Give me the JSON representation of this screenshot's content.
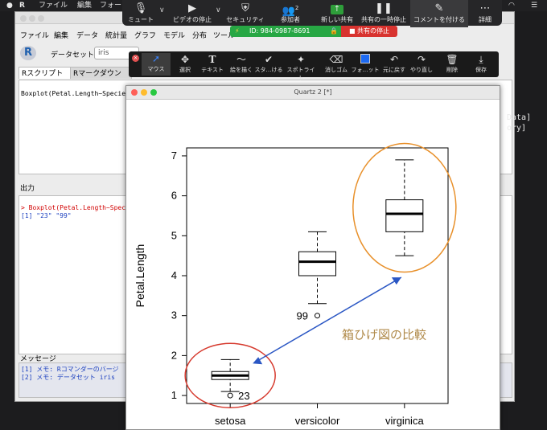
{
  "menubar": {
    "apple": "",
    "app": "R",
    "file": "ファイル",
    "edit": "編集",
    "format": "フォー"
  },
  "rcmdr": {
    "menu": [
      "ファイル",
      "編集",
      "データ",
      "統計量",
      "グラフ",
      "モデル",
      "分布",
      "ツール"
    ],
    "dataset_label": "データセット：",
    "dataset_value": "iris",
    "tabs": {
      "script": "Rスクリプト",
      "markdown": "Rマークダウン"
    },
    "script_text": "Boxplot(Petal.Length~Specie",
    "output_label": "出力",
    "output_lines": [
      "> Boxplot(Petal.Length~Spec",
      "[1] \"23\" \"99\""
    ],
    "messages_label": "メッセージ",
    "messages": [
      "[1] メモ: Rコマンダーのバージ",
      "[2] メモ: データセット iris"
    ],
    "right_text": [
      "Data]",
      "ory]"
    ]
  },
  "zoom": {
    "mute": "ミュート",
    "video": "ビデオの停止",
    "security": "セキュリティ",
    "participants": "参加者",
    "participants_count": "2",
    "share": "新しい共有",
    "pause": "共有の一時停止",
    "annotate": "コメントを付ける",
    "more": "詳細",
    "meeting_id": "ID: 984-0987-8691",
    "stop_share": "共有の停止"
  },
  "annotate_tools": {
    "mouse": "マウス",
    "select": "選択",
    "text": "テキスト",
    "draw": "絵を描く",
    "stamp": "スタ…ける",
    "spotlight": "スポトライト",
    "eraser": "消しゴム",
    "format": "フォ…ット",
    "undo": "元に戻す",
    "redo": "やり直し",
    "delete": "削除",
    "save": "保存"
  },
  "quartz": {
    "title": "Quartz 2 [*]"
  },
  "chart_data": {
    "type": "boxplot",
    "title": "",
    "xlabel": "",
    "ylabel": "Petal.Length",
    "ylim": [
      0.8,
      7.2
    ],
    "yticks": [
      1,
      2,
      3,
      4,
      5,
      6,
      7
    ],
    "categories": [
      "setosa",
      "versicolor",
      "virginica"
    ],
    "boxes": [
      {
        "whisker_low": 1.1,
        "q1": 1.4,
        "median": 1.5,
        "q3": 1.6,
        "whisker_high": 1.9,
        "outliers": [
          {
            "value": 1.0,
            "label": "23"
          }
        ]
      },
      {
        "whisker_low": 3.3,
        "q1": 4.0,
        "median": 4.35,
        "q3": 4.6,
        "whisker_high": 5.1,
        "outliers": [
          {
            "value": 3.0,
            "label": "99"
          }
        ]
      },
      {
        "whisker_low": 4.5,
        "q1": 5.1,
        "median": 5.55,
        "q3": 5.9,
        "whisker_high": 6.9,
        "outliers": []
      }
    ],
    "annotation": {
      "text": "箱ひげ図の比較",
      "color": "#b08a4a"
    },
    "colors": {
      "circle_setosa": "#d63a2e",
      "circle_virginica": "#e8902a",
      "arrow": "#2b57c4"
    }
  }
}
